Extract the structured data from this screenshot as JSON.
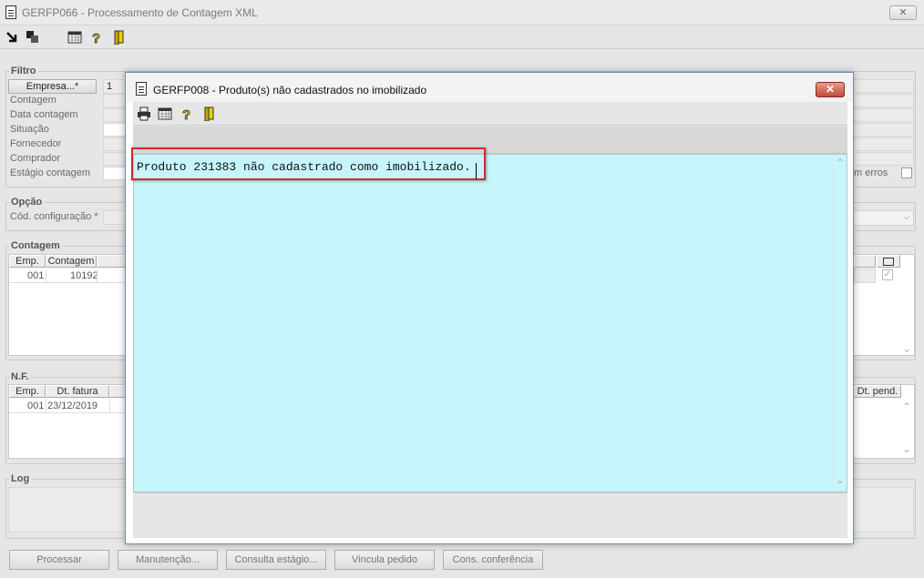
{
  "main": {
    "title": "GERFP066 - Processamento de Contagem XML",
    "close_label": "✕"
  },
  "filtro": {
    "legend": "Filtro",
    "empresa_button": "Empresa...*",
    "empresa_value": "1",
    "labels": [
      "Contagem",
      "Data contagem",
      "Situação",
      "Fornecedor",
      "Comprador",
      "Estágio contagem"
    ],
    "com_erros_label": "m erros"
  },
  "opcao": {
    "legend": "Opção",
    "cod_label": "Cód. configuração *"
  },
  "contagem": {
    "legend": "Contagem",
    "columns": [
      "Emp.",
      "Contagem"
    ],
    "rows": [
      {
        "emp": "001",
        "contagem": "10192"
      }
    ]
  },
  "nf": {
    "legend": "N.F.",
    "columns": [
      "Emp.",
      "Dt. fatura"
    ],
    "rows": [
      {
        "emp": "001",
        "dt_fatura": "23/12/2019"
      }
    ],
    "right_column": "Dt. pend."
  },
  "log": {
    "legend": "Log"
  },
  "actions": [
    "Processar",
    "Manutenção...",
    "Consulta estágio...",
    "Vincula pedido",
    "Cons. conferência"
  ],
  "dialog": {
    "title": "GERFP008 - Produto(s) não cadastrados no imobilizado",
    "close_label": "✕",
    "message": "Produto 231383 não cadastrado como imobilizado."
  },
  "icons": [
    "arrow-icon",
    "export-icon",
    "calendar-grid-icon",
    "help-icon",
    "exit-door-icon",
    "print-icon"
  ],
  "colors": {
    "memo_background": "#c6f5fb",
    "highlight": "#d9252b",
    "dialog_close": "#c34b3b"
  }
}
